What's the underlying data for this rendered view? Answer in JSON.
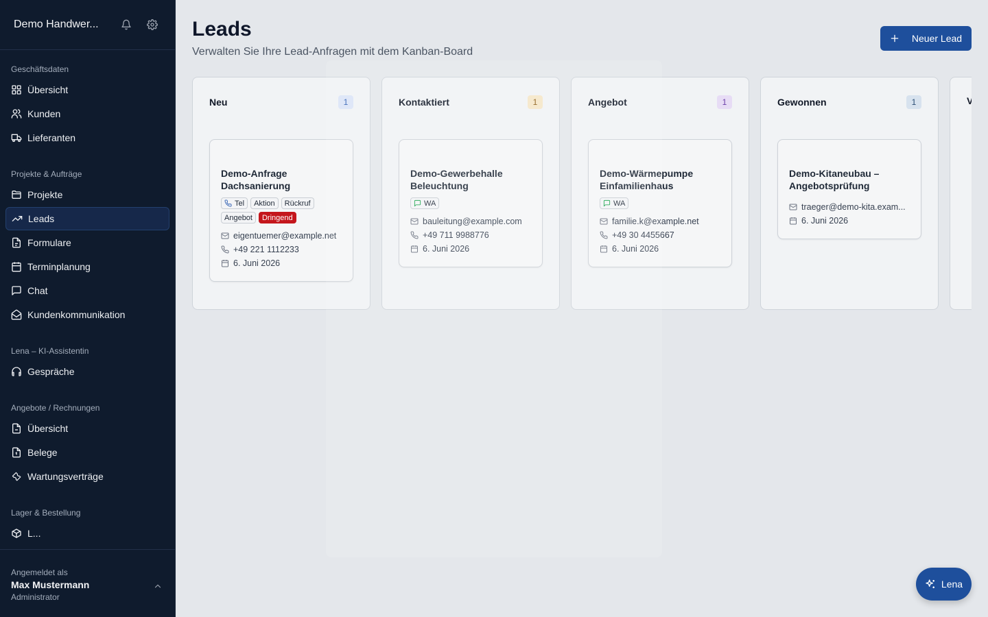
{
  "sidebar": {
    "company": "Demo Handwer...",
    "sections": {
      "business": "Geschäftsdaten",
      "projects": "Projekte & Aufträge",
      "ai": "Lena – KI-Assistentin",
      "offers": "Angebote / Rechnungen",
      "stock": "Lager & Bestellung"
    },
    "items": {
      "overview": "Übersicht",
      "customers": "Kunden",
      "suppliers": "Lieferanten",
      "projects": "Projekte",
      "leads": "Leads",
      "forms": "Formulare",
      "scheduling": "Terminplanung",
      "chat": "Chat",
      "communication": "Kundenkommunikation",
      "conversations": "Gespräche",
      "offers_overview": "Übersicht",
      "receipts": "Belege",
      "maintenance": "Wartungsverträge",
      "stock_partial": "L..."
    },
    "user": {
      "label": "Angemeldet als",
      "name": "Max Mustermann",
      "role": "Administrator"
    }
  },
  "header": {
    "title": "Leads",
    "subtitle": "Verwalten Sie Ihre Lead-Anfragen mit dem Kanban-Board",
    "new_lead": "Neuer Lead"
  },
  "columns": [
    {
      "title": "Neu",
      "count": "1",
      "badge_bg": "#dbe4f7",
      "badge_fg": "#2f5fb3",
      "card": {
        "title": "Demo-Anfrage Dachsanierung",
        "tags": [
          "Tel",
          "Aktion",
          "Rückruf",
          "Angebot",
          "Dringend"
        ],
        "email": "eigentuemer@example.net",
        "phone": "+49 221 1112233",
        "date": "6. Juni 2026"
      }
    },
    {
      "title": "Kontaktiert",
      "count": "1",
      "badge_bg": "#f5e6c8",
      "badge_fg": "#8a5a12",
      "card": {
        "title": "Demo-Gewerbehalle Beleuchtung",
        "tags": [
          "WA"
        ],
        "email": "bauleitung@example.com",
        "phone": "+49 711 9988776",
        "date": "6. Juni 2026"
      }
    },
    {
      "title": "Angebot",
      "count": "1",
      "badge_bg": "#e7dcf5",
      "badge_fg": "#6b3fa8",
      "card": {
        "title": "Demo-Wärmepumpe Einfamilienhaus",
        "tags": [
          "WA"
        ],
        "email": "familie.k@example.net",
        "phone": "+49 30 4455667",
        "date": "6. Juni 2026"
      }
    },
    {
      "title": "Gewonnen",
      "count": "1",
      "badge_bg": "#d7e2ee",
      "badge_fg": "#2b4d74",
      "card": {
        "title": "Demo-Kitaneubau – Angebotsprüfung",
        "email": "traeger@demo-kita.exam...",
        "date": "6. Juni 2026"
      }
    },
    {
      "title": "V"
    }
  ],
  "colors": {
    "accent": "#1e4f9c",
    "sidebar_bg": "#0f1b2d",
    "urgent": "#c4161c",
    "whatsapp": "#16a34a"
  },
  "fab": {
    "label": "Lena"
  }
}
